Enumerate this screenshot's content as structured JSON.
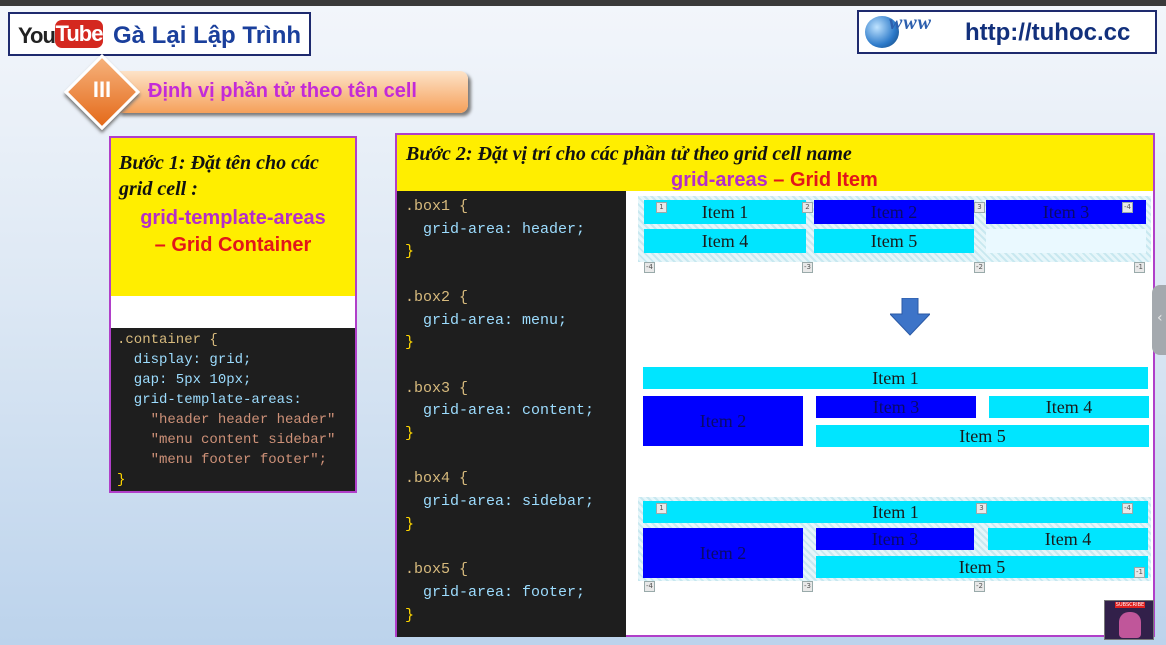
{
  "header": {
    "yt_you": "You",
    "yt_tube": "Tube",
    "channel": "Gà Lại Lập Trình",
    "www": "www",
    "url": "http://tuhoc.cc"
  },
  "section": {
    "number": "III",
    "title": "Định vị phần tử theo tên cell"
  },
  "step1": {
    "title": "Bước 1:  Đặt tên cho các grid cell :",
    "property": "grid-template-areas",
    "role": "– Grid Container",
    "code": [
      ".container {",
      "  display: grid;",
      "  gap: 5px 10px;",
      "  grid-template-areas:",
      "    \"header header header\"",
      "    \"menu content sidebar\"",
      "    \"menu footer footer\";",
      "}"
    ]
  },
  "step2": {
    "title": "Bước 2:  Đặt vị trí cho các phần tử theo grid cell name",
    "property": "grid-areas",
    "role": "– Grid Item",
    "code": [
      ".box1 {",
      "  grid-area: header;",
      "}",
      "",
      ".box2 {",
      "  grid-area: menu;",
      "}",
      "",
      ".box3 {",
      "  grid-area: content;",
      "}",
      "",
      ".box4 {",
      "  grid-area: sidebar;",
      "}",
      "",
      ".box5 {",
      "  grid-area: footer;",
      "}"
    ]
  },
  "items": [
    "Item 1",
    "Item 2",
    "Item 3",
    "Item 4",
    "Item 5"
  ],
  "overlay": {
    "line_labels": [
      "1",
      "2",
      "3",
      "-4",
      "-3",
      "-2",
      "-1",
      "4"
    ]
  },
  "avatar": {
    "badge": "SUBSCRIBE"
  },
  "colors": {
    "yellow": "#ffee00",
    "cyan": "#00e5ff",
    "blue": "#0000ff",
    "purple_border": "#b03fc9",
    "title_purple": "#b42ec9",
    "red": "#e2161a",
    "code_bg": "#1e1e1e"
  }
}
